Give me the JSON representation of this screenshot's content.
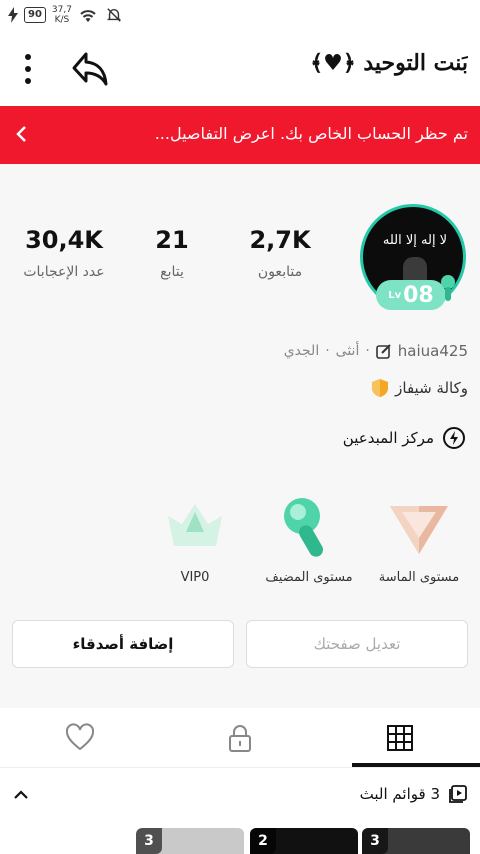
{
  "status_bar": {
    "battery": "90",
    "speed_value": "37,7",
    "speed_unit": "K/S"
  },
  "header": {
    "title": "بَنت التوحيد ﴿♥﴾"
  },
  "banner": {
    "text": "تم حظر الحساب الخاص بك. اعرض التفاصيل..."
  },
  "avatar": {
    "flag_text": "لا إله إلا الله",
    "level_prefix": "Lv",
    "level": "08"
  },
  "stats": [
    {
      "value": "2,7K",
      "label": "متابعون"
    },
    {
      "value": "21",
      "label": "يتابع"
    },
    {
      "value": "30,4K",
      "label": "عدد الإعجابات"
    }
  ],
  "profile": {
    "handle": "haiua425",
    "gender": "أنثى",
    "zodiac": "الجدي",
    "agency": "وكالة شيفاز",
    "creator_center": "مركز المبدعين"
  },
  "levels": [
    {
      "label": "مستوى الماسة"
    },
    {
      "label": "مستوى المضيف"
    },
    {
      "label": "VIP0"
    }
  ],
  "buttons": {
    "edit_profile": "تعديل صفحتك",
    "add_friends": "إضافة أصدقاء"
  },
  "playlists": {
    "label": "3 قوائم البث"
  },
  "thumbnails": [
    {
      "count": "3"
    },
    {
      "count": "2"
    },
    {
      "count": "3"
    }
  ],
  "colors": {
    "banner": "#f0182c",
    "accent": "#23c9a8"
  }
}
